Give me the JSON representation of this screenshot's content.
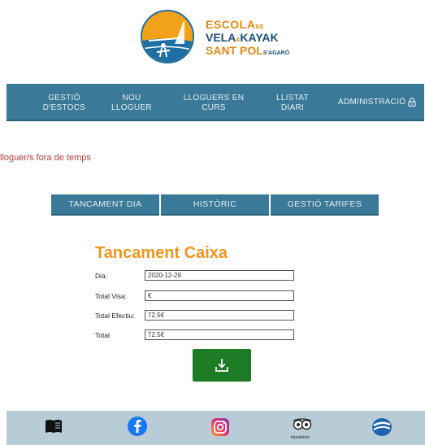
{
  "logo": {
    "line1": "ESCOLA",
    "line1_small": "DE",
    "line2a": "VELA",
    "line2_small": "&",
    "line2b": "KAYAK",
    "line3": "SANT POL",
    "line3_small": "S'AGARÓ"
  },
  "nav": {
    "items": [
      {
        "line1": "GESTIÓ",
        "line2": "D'ESTOCS"
      },
      {
        "line1": "NOU",
        "line2": "LLOGUER"
      },
      {
        "line1": "LLOGUERS EN",
        "line2": "CURS"
      },
      {
        "line1": "LLISTAT",
        "line2": "DIARI"
      },
      {
        "line1": "ADMINISTRACIÓ",
        "line2": ""
      }
    ]
  },
  "alert": {
    "text": "lloguer/s fora de temps"
  },
  "subnav": {
    "buttons": [
      "TANCAMENT DIA",
      "HISTÒRIC",
      "GESTIÓ TARIFES"
    ]
  },
  "form": {
    "title": "Tancament Caixa",
    "rows": [
      {
        "label": "Dia:",
        "value": "2020-12-29"
      },
      {
        "label": "Total Visa:",
        "value": "€"
      },
      {
        "label": "Total Efectiu:",
        "value": "72.5€"
      },
      {
        "label": "Total",
        "value": "72.5€"
      }
    ]
  },
  "footer": {
    "icons": [
      "book-icon",
      "facebook-icon",
      "instagram-icon",
      "tripadvisor-icon",
      "brand-swirl-icon"
    ],
    "tripadvisor_text": "tripadvisor"
  },
  "colors": {
    "nav_bg": "#3a7a98",
    "accent_orange": "#f0961d",
    "download_green": "#1e7b25",
    "alert_red": "#b23a3a",
    "footer_bg": "#b8ccd8"
  }
}
